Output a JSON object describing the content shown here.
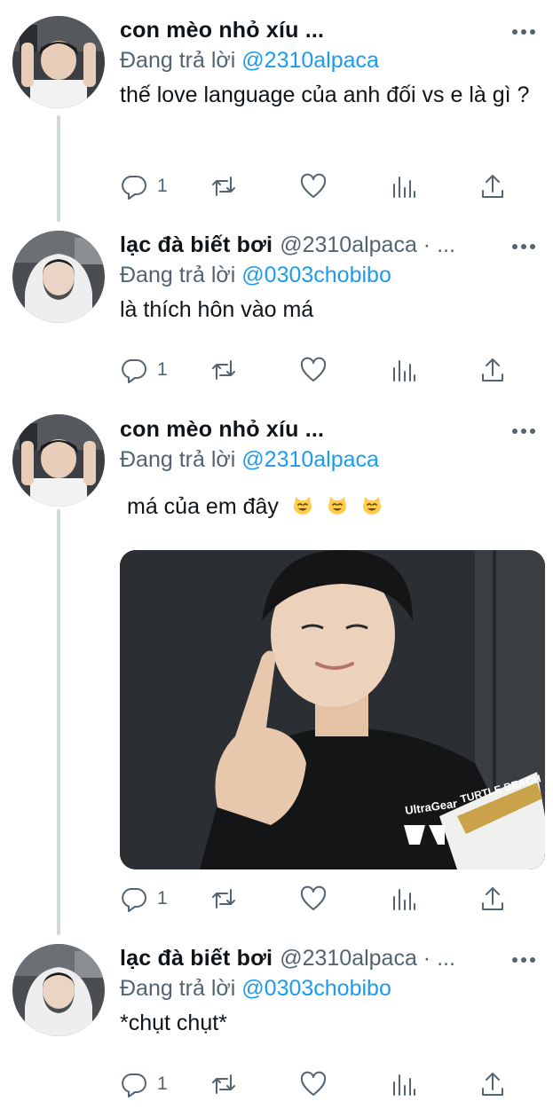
{
  "tweets": [
    {
      "author_name": "con mèo nhỏ xíu",
      "author_suffix": " ...",
      "handle": "",
      "reply_label": "Đang trả lời ",
      "reply_handle": "@2310alpaca",
      "text": "thế love language của anh đối vs e là gì ?",
      "reply_count": "1"
    },
    {
      "author_name": "lạc đà biết bơi",
      "author_suffix": "",
      "handle": "@2310alpaca · ...",
      "reply_label": "Đang trả lời ",
      "reply_handle": "@0303chobibo",
      "text": "là thích hôn vào má",
      "reply_count": "1"
    },
    {
      "author_name": "con mèo nhỏ xíu",
      "author_suffix": " ...",
      "handle": "",
      "reply_label": "Đang trả lời ",
      "reply_handle": "@2310alpaca",
      "text": "má của em đây",
      "emoji": [
        "cat-face-icon",
        "cat-face-icon",
        "cat-face-icon"
      ],
      "has_photo": true,
      "photo_text": [
        "UltraGear",
        "TURTLE BEACH"
      ],
      "reply_count": "1"
    },
    {
      "author_name": "lạc đà biết bơi",
      "author_suffix": "",
      "handle": "@2310alpaca · ...",
      "reply_label": "Đang trả lời ",
      "reply_handle": "@0303chobibo",
      "text": "*chụt chụt*",
      "reply_count": "1"
    }
  ],
  "icons": {
    "reply": "reply-icon",
    "retweet": "retweet-icon",
    "like": "heart-icon",
    "views": "views-icon",
    "share": "share-icon",
    "more": "more-icon"
  },
  "colors": {
    "link": "#1d9bf0",
    "secondary_text": "#536471",
    "thread_line": "#cfd9de"
  }
}
